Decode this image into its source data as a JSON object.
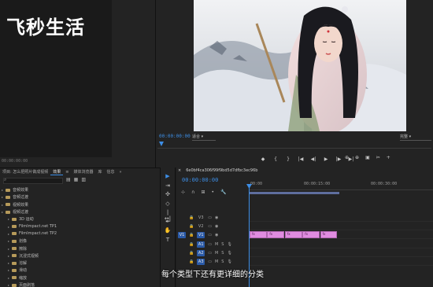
{
  "watermark": "飞秒生活",
  "source": {
    "timecode": "00:00:00:00"
  },
  "program": {
    "timecode": "00:00:00:00",
    "fit": "适合",
    "quality": "完整",
    "transport": [
      "◆",
      "{",
      "}",
      "|◀",
      "◀|",
      "▶",
      "|▶",
      "▶|"
    ],
    "right_controls": [
      "⊕",
      "⊕",
      "▣",
      "✂",
      "+"
    ]
  },
  "effects": {
    "tabs": [
      "项目: 怎么把照片做成视频",
      "效果",
      "≡",
      "媒体浏览器",
      "库",
      "信息",
      "»"
    ],
    "active_tab": 1,
    "filter_icons": [
      "▤",
      "▦",
      "▥"
    ],
    "items": [
      {
        "label": "音频效果",
        "sub": false,
        "folder": true
      },
      {
        "label": "音频过渡",
        "sub": false,
        "folder": true
      },
      {
        "label": "视频效果",
        "sub": false,
        "folder": true
      },
      {
        "label": "视频过渡",
        "sub": false,
        "folder": true
      },
      {
        "label": "3D 运动",
        "sub": true,
        "folder": true
      },
      {
        "label": "FilmImpact.net TP1",
        "sub": true,
        "folder": true
      },
      {
        "label": "FilmImpact.net TP2",
        "sub": true,
        "folder": true
      },
      {
        "label": "划像",
        "sub": true,
        "folder": true
      },
      {
        "label": "擦除",
        "sub": true,
        "folder": true
      },
      {
        "label": "沉浸式视频",
        "sub": true,
        "folder": true
      },
      {
        "label": "溶解",
        "sub": true,
        "folder": true
      },
      {
        "label": "滑动",
        "sub": true,
        "folder": true
      },
      {
        "label": "缩放",
        "sub": true,
        "folder": true
      },
      {
        "label": "页面剥落",
        "sub": true,
        "folder": true
      }
    ]
  },
  "tools": [
    "▶",
    "⇥",
    "✣",
    "◇",
    "|↔|",
    "✒",
    "✋",
    "T"
  ],
  "timeline": {
    "tab_label": "6e0bf4ca306f99f9bd5d7dfbc3ec96b",
    "close": "×",
    "timecode": "00:00:00:00",
    "toolbar": [
      "⊹",
      "∩",
      "⊞",
      "•",
      "🔧"
    ],
    "ruler": [
      "00:00",
      "00:00:15:00",
      "00:00:30:00"
    ],
    "video_tracks": [
      {
        "name": "V3",
        "target": false
      },
      {
        "name": "V2",
        "target": false
      },
      {
        "name": "V1",
        "target": true,
        "src": "V1"
      }
    ],
    "audio_tracks": [
      {
        "name": "A1",
        "target": true
      },
      {
        "name": "A2",
        "target": true
      },
      {
        "name": "A3",
        "target": true
      }
    ],
    "track_icons": {
      "lock": "🔒",
      "sync": "▭",
      "eye": "◉",
      "mute": "M",
      "solo": "S",
      "mic": "🎙"
    },
    "clips": [
      {
        "label": "fx"
      },
      {
        "label": "fx"
      },
      {
        "label": "fx"
      },
      {
        "label": "fx"
      },
      {
        "label": "fx"
      }
    ]
  },
  "subtitle": "每个类型下还有更详细的分类"
}
